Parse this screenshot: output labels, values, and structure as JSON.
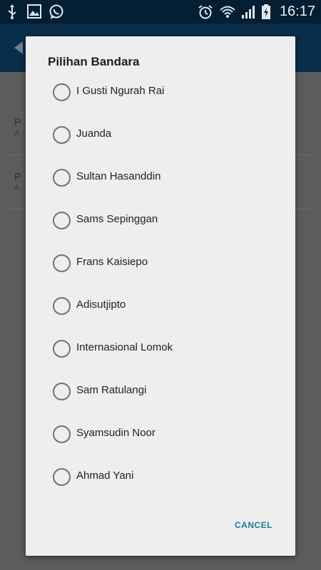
{
  "status_bar": {
    "time": "16:17",
    "left_icons": [
      "usb-icon",
      "image-icon",
      "whatsapp-icon"
    ],
    "right_icons": [
      "alarm-icon",
      "wifi-icon",
      "signal-icon",
      "battery-charging-icon"
    ]
  },
  "underlying_list": {
    "items": [
      {
        "title_fragment": "P",
        "subtitle_fragment": "A"
      },
      {
        "title_fragment": "P",
        "subtitle_fragment": "A"
      }
    ]
  },
  "dialog": {
    "title": "Pilihan Bandara",
    "options": [
      {
        "label": "I Gusti Ngurah Rai",
        "selected": false
      },
      {
        "label": "Juanda",
        "selected": false
      },
      {
        "label": "Sultan Hasanddin",
        "selected": false
      },
      {
        "label": "Sams Sepinggan",
        "selected": false
      },
      {
        "label": "Frans Kaisiepo",
        "selected": false
      },
      {
        "label": "Adisutjipto",
        "selected": false
      },
      {
        "label": "Internasional Lomok",
        "selected": false
      },
      {
        "label": "Sam Ratulangi",
        "selected": false
      },
      {
        "label": "Syamsudin Noor",
        "selected": false
      },
      {
        "label": "Ahmad Yani",
        "selected": false
      }
    ],
    "cancel_label": "CANCEL"
  },
  "colors": {
    "status_bar_bg": "#041e33",
    "app_bar_bg": "#0a2d49",
    "dialog_bg": "#eeeeee",
    "accent": "#1f7a91"
  }
}
